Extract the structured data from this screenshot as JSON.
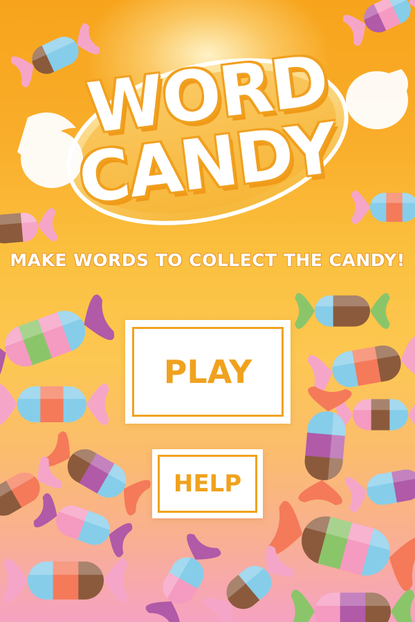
{
  "game": {
    "title_line1": "WORD",
    "title_line2": "CANDY",
    "tagline": "MAKE WORDS TO COLLECT THE CANDY!"
  },
  "menu": {
    "play_label": "PLAY",
    "help_label": "HELP"
  },
  "colors": {
    "accent": "#f0a21e",
    "background_top": "#f7a41c",
    "background_bottom": "#f6a2c2",
    "button_bg": "#ffffff"
  }
}
